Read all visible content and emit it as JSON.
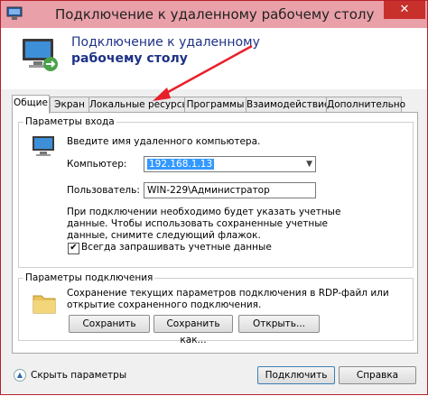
{
  "window": {
    "title": "Подключение к удаленному рабочему столу",
    "close_label": "✕"
  },
  "header": {
    "title_line1": "Подключение к удаленному",
    "title_line2": "рабочему столу"
  },
  "tabs": [
    {
      "label": "Общие",
      "active": true
    },
    {
      "label": "Экран"
    },
    {
      "label": "Локальные ресурсы"
    },
    {
      "label": "Программы"
    },
    {
      "label": "Взаимодействие"
    },
    {
      "label": "Дополнительно"
    }
  ],
  "login_group": {
    "legend": "Параметры входа",
    "prompt": "Введите имя удаленного компьютера.",
    "computer_label": "Компьютер:",
    "computer_value": "192.168.1.13",
    "user_label": "Пользователь:",
    "user_value": "WIN-229\\Администратор",
    "note_line1": "При подключении необходимо будет указать учетные",
    "note_line2": "данные. Чтобы использовать сохраненные учетные",
    "note_line3": "данные, снимите следующий флажок.",
    "always_ask_label": "Всегда запрашивать учетные данные",
    "always_ask_checked": true
  },
  "conn_group": {
    "legend": "Параметры подключения",
    "desc_line1": "Сохранение текущих параметров подключения в RDP-файл или",
    "desc_line2": "открытие сохраненного подключения.",
    "save_label": "Сохранить",
    "save_as_label": "Сохранить как...",
    "open_label": "Открыть..."
  },
  "footer": {
    "hide_options_label": "Скрыть параметры",
    "connect_label": "Подключить",
    "help_label": "Справка"
  },
  "colors": {
    "titlebar": "#e9a0a8",
    "close_button": "#c7302b",
    "header_text": "#1e3287",
    "annotation_arrow": "#e8202a"
  }
}
